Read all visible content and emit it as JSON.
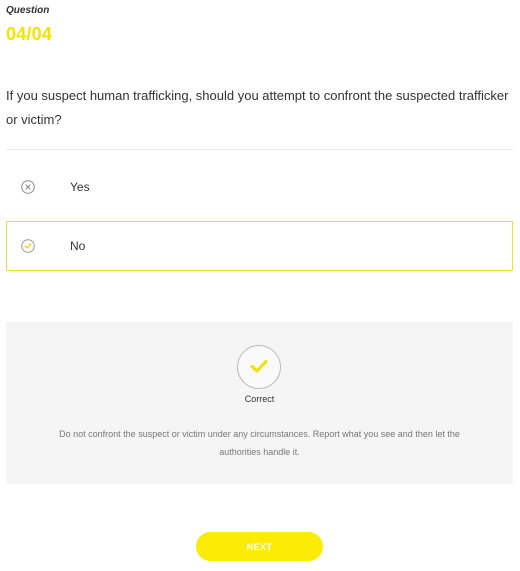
{
  "question": {
    "label": "Question",
    "counter": "04/04",
    "text": "If you suspect human trafficking, should you attempt to confront the suspected trafficker or victim?"
  },
  "options": [
    {
      "label": "Yes",
      "state": "incorrect",
      "icon": "x-circle-icon"
    },
    {
      "label": "No",
      "state": "selected-correct",
      "icon": "check-circle-icon"
    }
  ],
  "feedback": {
    "icon": "check-icon",
    "status": "Correct",
    "text": "Do not confront the suspect or victim under any circumstances. Report what you see and then let the authorities handle it."
  },
  "next_button": {
    "label": "NEXT"
  },
  "colors": {
    "accent": "#f5e200",
    "button": "#fbeb05",
    "selected_border": "#efe13a",
    "feedback_bg": "#f5f5f5"
  }
}
